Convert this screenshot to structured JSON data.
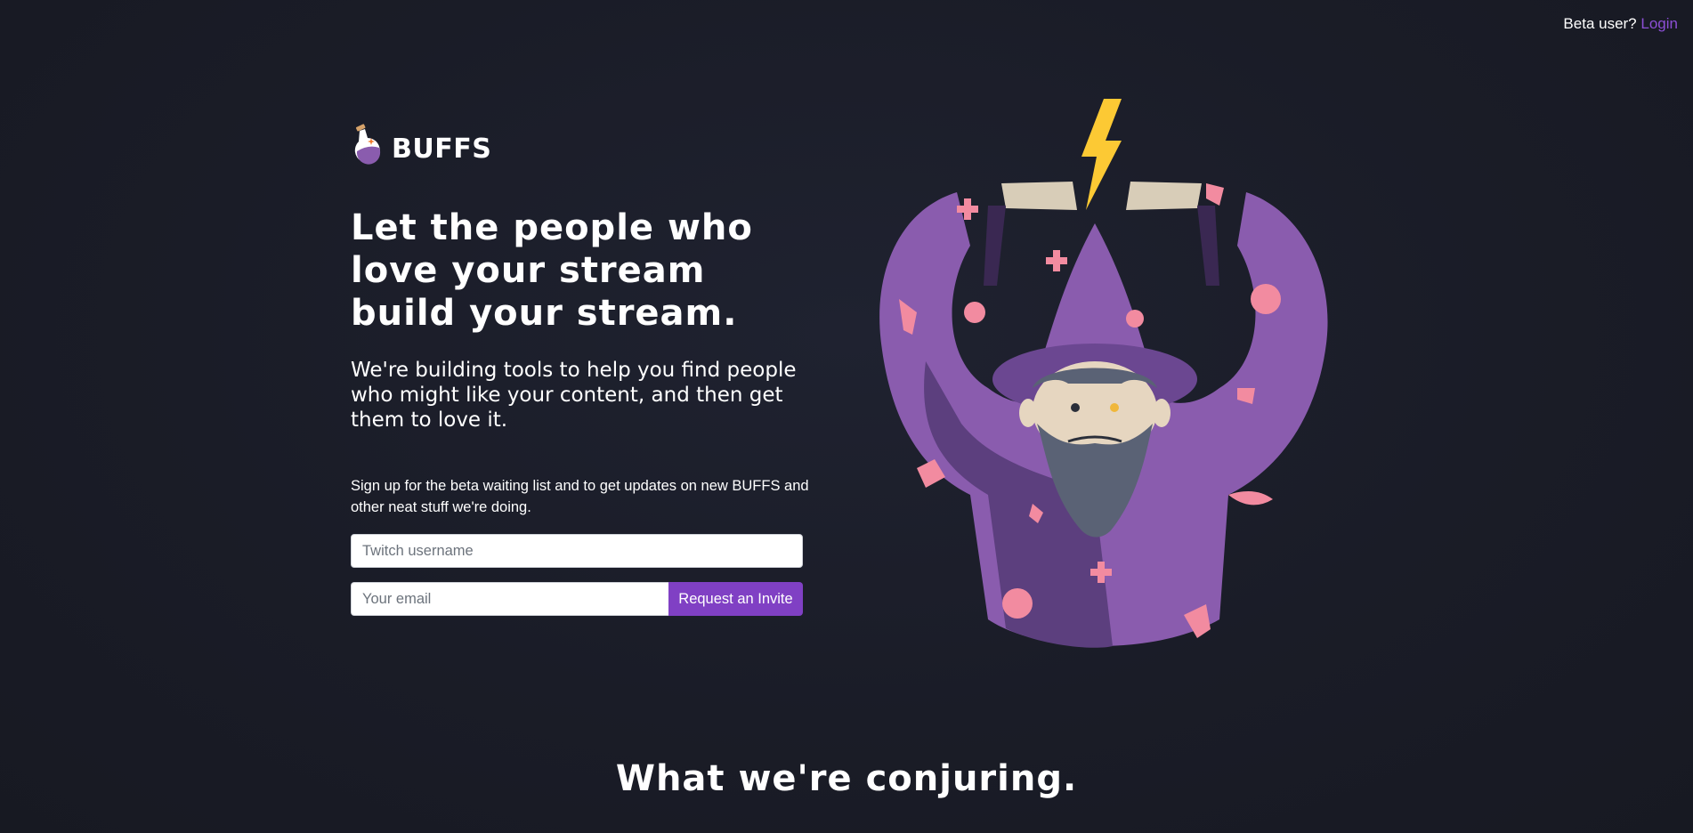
{
  "header": {
    "beta_prompt": "Beta user?",
    "login_label": "Login"
  },
  "brand": {
    "name": "BUFFS",
    "logo_icon": "potion-flask-icon"
  },
  "hero": {
    "headline": "Let the people who love your stream build your stream.",
    "subheadline": "We're building tools to help you find people who might like your content, and then get them to love it.",
    "illustration": "wizard-casting-lightning"
  },
  "signup": {
    "description": "Sign up for the beta waiting list and to get updates on new BUFFS and other neat stuff we're doing.",
    "username_value": "",
    "username_placeholder": "Twitch username",
    "email_value": "",
    "email_placeholder": "Your email",
    "submit_label": "Request an Invite"
  },
  "features": {
    "title": "What we're conjuring."
  },
  "colors": {
    "background": "#1b1d28",
    "accent": "#8040c4",
    "link": "#8c4fd6",
    "robe": "#8a5cae",
    "robe_dark": "#5c3f7e",
    "pink": "#f28ba0",
    "lightning": "#fcc934"
  }
}
